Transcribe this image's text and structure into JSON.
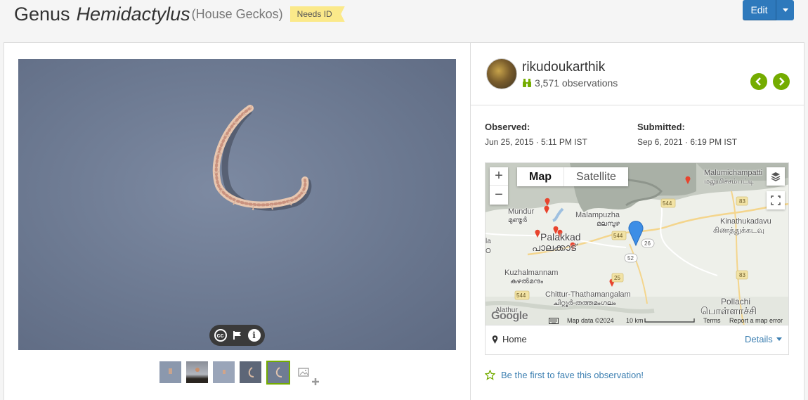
{
  "header": {
    "title_prefix": "Genus",
    "genus": "Hemidactylus",
    "common_name": "(House Geckos)",
    "status_badge": "Needs ID",
    "edit_label": "Edit"
  },
  "photo": {
    "controls": [
      "cc-icon",
      "flag-icon",
      "info-icon"
    ],
    "cc_text": "cc",
    "info_text": "i",
    "thumbnail_count": 5,
    "selected_thumbnail": 5
  },
  "user": {
    "name": "rikudoukarthik",
    "observations": "3,571 observations"
  },
  "dates": {
    "observed_label": "Observed:",
    "observed_value": "Jun 25, 2015 · 5:11 PM IST",
    "submitted_label": "Submitted:",
    "submitted_value": "Sep 6, 2021 · 6:19 PM IST"
  },
  "map": {
    "type_map": "Map",
    "type_satellite": "Satellite",
    "zoom_in": "+",
    "zoom_out": "−",
    "labels": {
      "malumichampatti_en": "Malumichampatti",
      "malumichampatti_ta": "மலுமிச்சம்பட்டி",
      "mundur_en": "Mundur",
      "mundur_ml": "മുണ്ടൂർ",
      "malampuzha_en": "Malampuzha",
      "malampuzha_ml": "മലമ്പുഴ",
      "palakkad_en": "Palakkad",
      "palakkad_ml": "പാലക്കാട്",
      "kinathukadavu_en": "Kinathukadavu",
      "kinathukadavu_ta": "கிணத்துக்கடவு",
      "kuzhalmannam_en": "Kuzhalmannam",
      "kuzhalmannam_ml": "കുഴൽമന്ദം",
      "chittur_en": "Chittur-Thathamangalam",
      "chittur_ml": "ചിറ്റൂർ-തത്തമംഗലം",
      "pollachi_en": "Pollachi",
      "pollachi_ta": "பொள்ளாச்சி",
      "alathur": "Alathur",
      "edge_la": "la",
      "edge_o": "O"
    },
    "roads": [
      "544",
      "83",
      "544",
      "26",
      "52",
      "25",
      "544",
      "83"
    ],
    "attribution": {
      "google": "Google",
      "map_data": "Map data ©2024",
      "scale": "10 km",
      "terms": "Terms",
      "report": "Report a map error"
    },
    "place_guess": "Home",
    "details_label": "Details"
  },
  "fave": {
    "label": "Be the first to fave this observation!"
  },
  "colors": {
    "accent_green": "#74ac00",
    "edit_blue": "#2e79bc",
    "link_blue": "#3c7fb1",
    "badge_yellow": "#fbe98a"
  }
}
